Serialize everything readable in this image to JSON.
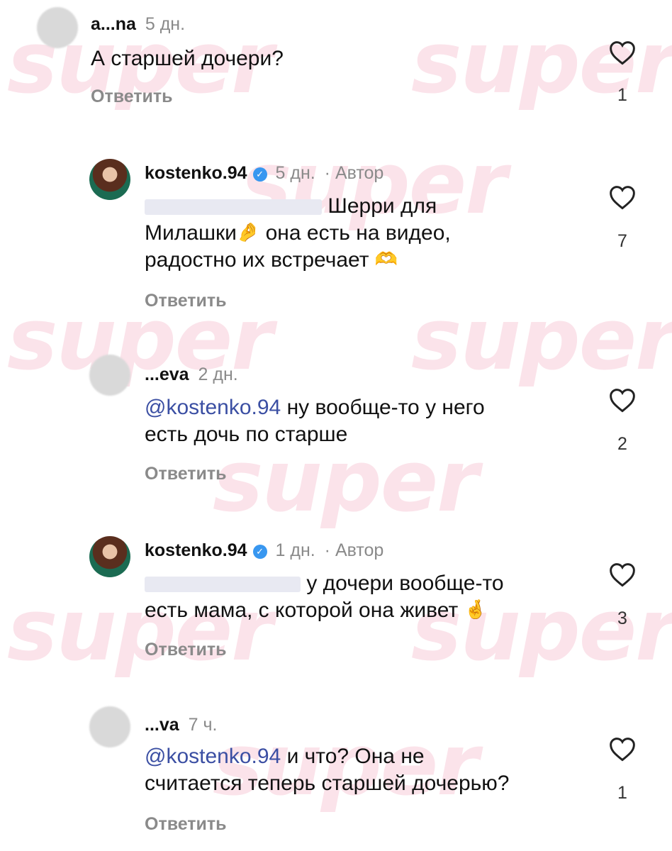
{
  "watermark": "super",
  "comments": [
    {
      "username": "a...na",
      "age": "5 дн.",
      "author_tag": "",
      "mention": "",
      "lines": [
        "А старшей дочери?"
      ],
      "reply_label": "Ответить",
      "likes": "1"
    },
    {
      "username": "kostenko.94",
      "age": "5 дн.",
      "author_tag": "· Автор",
      "mention": "@a...a",
      "lines": [
        "Шерри для",
        "Милашки",
        "она есть на видео,",
        "радостно их встречает"
      ],
      "emojis": [
        "🤌",
        "🫶"
      ],
      "reply_label": "Ответить",
      "likes": "7"
    },
    {
      "username": "...eva",
      "age": "2 дн.",
      "author_tag": "",
      "mention": "@kostenko.94",
      "lines": [
        "ну вообще-то у него",
        "есть дочь по старше"
      ],
      "reply_label": "Ответить",
      "likes": "2"
    },
    {
      "username": "kostenko.94",
      "age": "1 дн.",
      "author_tag": "· Автор",
      "mention": "@...a",
      "lines": [
        "у дочери вообще-то",
        "есть мама, с которой она живет"
      ],
      "emojis": [
        "🤞"
      ],
      "reply_label": "Ответить",
      "likes": "3"
    },
    {
      "username": "...va",
      "age": "7 ч.",
      "author_tag": "",
      "mention": "@kostenko.94",
      "lines": [
        "и что? Она не",
        "считается теперь старшей дочерью?"
      ],
      "reply_label": "Ответить",
      "likes": "1"
    }
  ],
  "icons": {
    "like": "heart-outline-icon",
    "verified": "verified-badge-icon"
  },
  "colors": {
    "mention": "#3b4fa3",
    "watermark": "#fbe3ea",
    "verified": "#3897f0"
  }
}
